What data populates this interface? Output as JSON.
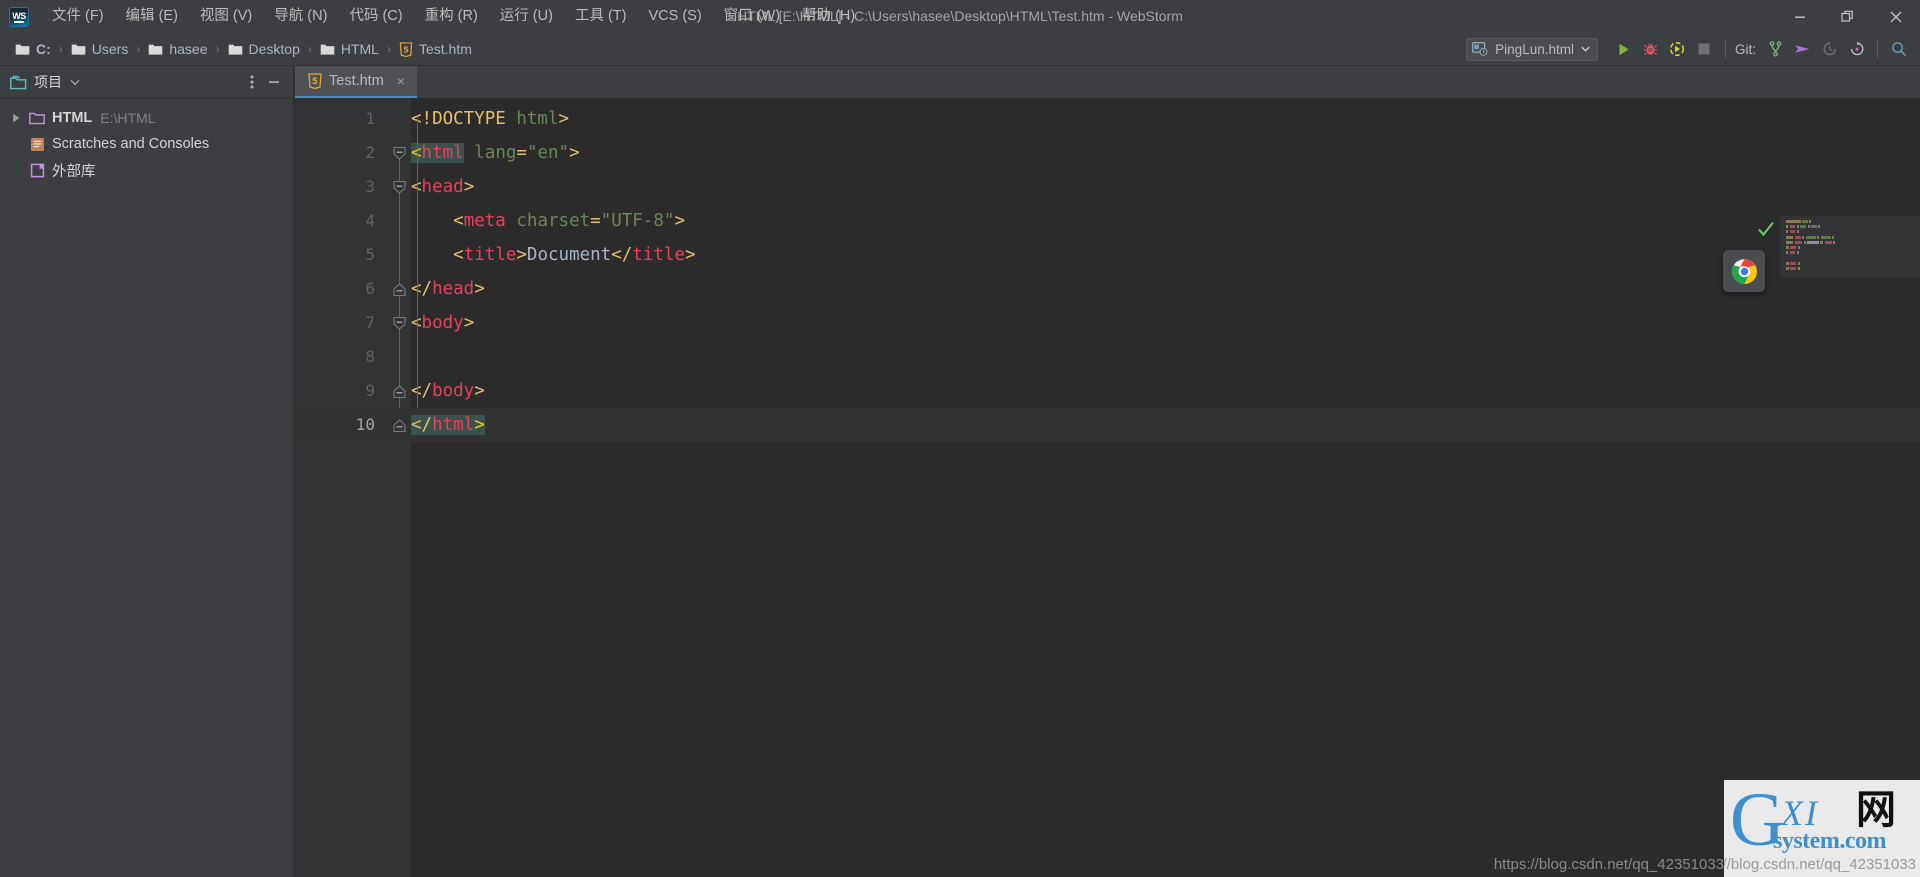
{
  "titlebar": {
    "app_icon": "webstorm-logo",
    "menus": [
      {
        "label": "文件 (F)"
      },
      {
        "label": "编辑 (E)"
      },
      {
        "label": "视图 (V)"
      },
      {
        "label": "导航 (N)"
      },
      {
        "label": "代码 (C)"
      },
      {
        "label": "重构 (R)"
      },
      {
        "label": "运行 (U)"
      },
      {
        "label": "工具 (T)"
      },
      {
        "label": "VCS (S)"
      },
      {
        "label": "窗口 (W)"
      },
      {
        "label": "帮助 (H)"
      }
    ],
    "window_title": "HTML [E:\\HTML] - C:\\Users\\hasee\\Desktop\\HTML\\Test.htm - WebStorm",
    "controls": {
      "minimize": "minimize-icon",
      "maximize": "restore-icon",
      "close": "close-icon"
    }
  },
  "navbar": {
    "breadcrumb": [
      {
        "label": "C:",
        "icon": "folder-icon",
        "bold": true
      },
      {
        "label": "Users",
        "icon": "folder-icon",
        "bold": false
      },
      {
        "label": "hasee",
        "icon": "folder-icon",
        "bold": false
      },
      {
        "label": "Desktop",
        "icon": "folder-icon",
        "bold": false
      },
      {
        "label": "HTML",
        "icon": "folder-icon",
        "bold": false
      },
      {
        "label": "Test.htm",
        "icon": "html5-icon",
        "bold": false
      }
    ],
    "separator": "›",
    "run_config": {
      "name": "PingLun.html",
      "icon": "browser-config-icon",
      "dropdown": "chevron-down-icon"
    },
    "buttons": [
      {
        "name": "run-button",
        "icon": "play-icon",
        "color": "#7cb342"
      },
      {
        "name": "debug-button",
        "icon": "bug-icon",
        "color": "#e8546b"
      },
      {
        "name": "run-coverage-button",
        "icon": "coverage-icon",
        "color": "#d6d636"
      },
      {
        "name": "stop-button",
        "icon": "stop-icon",
        "color": "#6e7173"
      }
    ],
    "git_label": "Git:",
    "git_buttons": [
      {
        "name": "git-branch-button",
        "icon": "branch-icon",
        "color": "#8aab8a"
      },
      {
        "name": "git-push-button",
        "icon": "push-arrow-icon",
        "color": "#b06ed6"
      },
      {
        "name": "git-update-button",
        "icon": "history-update-icon",
        "color": "#6e7173"
      },
      {
        "name": "git-rollback-button",
        "icon": "rollback-icon",
        "color": "#b9bcc0"
      }
    ],
    "search_button": {
      "name": "search-everywhere-button",
      "icon": "search-icon",
      "color": "#5a9bb5"
    }
  },
  "sidebar": {
    "header": {
      "icon": "project-folder-icon",
      "title": "项目",
      "chevron": "chevron-down-icon",
      "options_icon": "more-vertical-icon",
      "hide_icon": "minimize-icon"
    },
    "tree": [
      {
        "label": "HTML",
        "sub": "E:\\HTML",
        "icon": "project-module-icon",
        "arrow": "triangle-right-icon",
        "bold": true,
        "indent": 0
      },
      {
        "label": "Scratches and Consoles",
        "sub": "",
        "icon": "scratches-icon",
        "arrow": "",
        "bold": false,
        "indent": 1
      },
      {
        "label": "外部库",
        "sub": "",
        "icon": "external-libraries-icon",
        "arrow": "",
        "bold": false,
        "indent": 1
      }
    ]
  },
  "editor": {
    "tabs": [
      {
        "label": "Test.htm",
        "icon": "html5-icon",
        "close": "×",
        "active": true
      }
    ],
    "lines": [
      {
        "number": "1",
        "current": false,
        "fold": "",
        "tokens": [
          {
            "text": "<!DOCTYPE ",
            "cls": "t-doctype"
          },
          {
            "text": "html",
            "cls": "t-value"
          },
          {
            "text": ">",
            "cls": "t-punct"
          }
        ]
      },
      {
        "number": "2",
        "current": false,
        "fold": "expanded",
        "tokens": [
          {
            "text": "<",
            "cls": "t-caret-tag t-brmatch"
          },
          {
            "text": "html",
            "cls": "t-tag t-brmatch"
          },
          {
            "text": " ",
            "cls": "t-attr"
          },
          {
            "text": "lang",
            "cls": "t-value"
          },
          {
            "text": "=",
            "cls": "t-punct"
          },
          {
            "text": "\"en\"",
            "cls": "t-value"
          },
          {
            "text": ">",
            "cls": "t-punct"
          }
        ]
      },
      {
        "number": "3",
        "current": false,
        "fold": "expanded",
        "tokens": [
          {
            "text": "<",
            "cls": "t-punct"
          },
          {
            "text": "head",
            "cls": "t-tag"
          },
          {
            "text": ">",
            "cls": "t-punct"
          }
        ]
      },
      {
        "number": "4",
        "current": false,
        "fold": "",
        "tokens": [
          {
            "text": "    <",
            "cls": "t-punct"
          },
          {
            "text": "meta",
            "cls": "t-tag"
          },
          {
            "text": " ",
            "cls": "t-attr"
          },
          {
            "text": "charset",
            "cls": "t-value"
          },
          {
            "text": "=",
            "cls": "t-punct"
          },
          {
            "text": "\"UTF-8\"",
            "cls": "t-value"
          },
          {
            "text": ">",
            "cls": "t-punct"
          }
        ]
      },
      {
        "number": "5",
        "current": false,
        "fold": "",
        "tokens": [
          {
            "text": "    <",
            "cls": "t-punct"
          },
          {
            "text": "title",
            "cls": "t-tag"
          },
          {
            "text": ">",
            "cls": "t-punct"
          },
          {
            "text": "Document",
            "cls": "t-text"
          },
          {
            "text": "</",
            "cls": "t-punct"
          },
          {
            "text": "title",
            "cls": "t-tag"
          },
          {
            "text": ">",
            "cls": "t-punct"
          }
        ]
      },
      {
        "number": "6",
        "current": false,
        "fold": "collapsed-end",
        "tokens": [
          {
            "text": "</",
            "cls": "t-punct"
          },
          {
            "text": "head",
            "cls": "t-tag"
          },
          {
            "text": ">",
            "cls": "t-punct"
          }
        ]
      },
      {
        "number": "7",
        "current": false,
        "fold": "expanded",
        "tokens": [
          {
            "text": "<",
            "cls": "t-punct"
          },
          {
            "text": "body",
            "cls": "t-tag"
          },
          {
            "text": ">",
            "cls": "t-punct"
          }
        ]
      },
      {
        "number": "8",
        "current": false,
        "fold": "",
        "tokens": []
      },
      {
        "number": "9",
        "current": false,
        "fold": "collapsed-end",
        "tokens": [
          {
            "text": "</",
            "cls": "t-punct"
          },
          {
            "text": "body",
            "cls": "t-tag"
          },
          {
            "text": ">",
            "cls": "t-punct"
          }
        ]
      },
      {
        "number": "10",
        "current": true,
        "fold": "collapsed-end",
        "tokens": [
          {
            "text": "</",
            "cls": "t-punct t-brmatch"
          },
          {
            "text": "html",
            "cls": "t-tag t-brmatch"
          },
          {
            "text": ">",
            "cls": "t-caret-tag t-brmatch"
          }
        ]
      }
    ],
    "inspection_status": "no-errors-check-icon",
    "minimap": "code-minimap",
    "popup_icon": "chrome-icon"
  },
  "watermark": {
    "logo_g": "G",
    "logo_xi": "XI",
    "logo_wang": "网",
    "logo_sys": "system.com",
    "url": "https://blog.csdn.net/qq_42351033"
  },
  "colors": {
    "bg_chrome": "#3c3f41",
    "bg_editor": "#2b2b2b",
    "bg_gutter": "#313335",
    "tab_active_underline": "#4a88c7",
    "tag": "#e8405c",
    "punct": "#e8bf6a",
    "value": "#6a8759",
    "text": "#a9b7c6",
    "brace_match": "#3b514d",
    "current_line": "#323232"
  }
}
